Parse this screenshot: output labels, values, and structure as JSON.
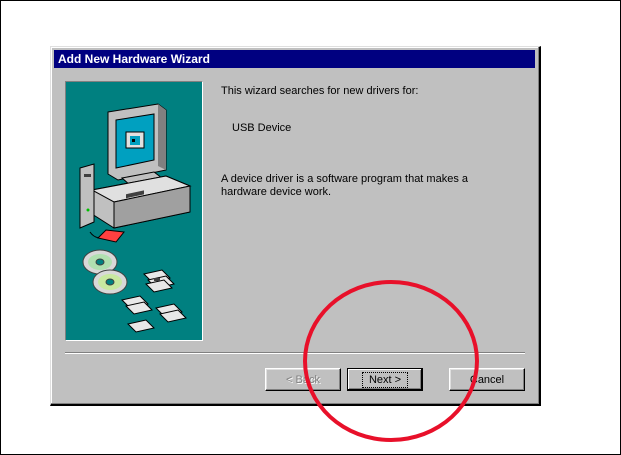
{
  "window": {
    "title": "Add New Hardware Wizard"
  },
  "content": {
    "intro": "This wizard searches for new drivers for:",
    "device_name": "USB Device",
    "description": "A device driver is a software program that makes a hardware device work."
  },
  "buttons": {
    "back": "< Back",
    "next": "Next >",
    "cancel": "Cancel"
  },
  "colors": {
    "title_bar": "#000080",
    "dialog_face": "#c0c0c0",
    "art_panel": "#008080",
    "annotation_circle": "#e8102a"
  },
  "icons": [
    "computer-icon",
    "cd-disc-icon",
    "floppy-disk-icon"
  ]
}
